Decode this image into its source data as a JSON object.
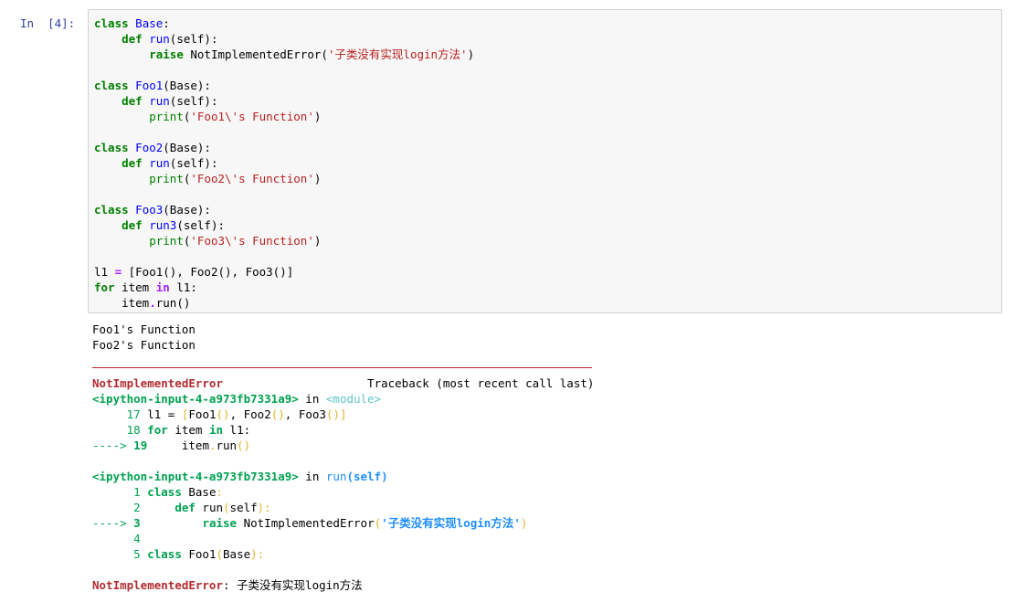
{
  "cell": {
    "prompt": "In  [4]:",
    "code": [
      "class Base:",
      "    def run(self):",
      "        raise NotImplementedError('子类没有实现login方法')",
      "",
      "class Foo1(Base):",
      "    def run(self):",
      "        print('Foo1\\'s Function')",
      "",
      "class Foo2(Base):",
      "    def run(self):",
      "        print('Foo2\\'s Function')",
      "",
      "class Foo3(Base):",
      "    def run3(self):",
      "        print('Foo3\\'s Function')",
      "",
      "l1 = [Foo1(), Foo2(), Foo3()]",
      "for item in l1:",
      "    item.run()"
    ]
  },
  "output": {
    "stdout": [
      "Foo1's Function",
      "Foo2's Function"
    ],
    "traceback": {
      "error_name": "NotImplementedError",
      "header_right": "Traceback (most recent call last)",
      "frame1": {
        "location": "<ipython-input-4-a973fb7331a9>",
        "in_text": " in ",
        "scope": "<module>",
        "lines": [
          {
            "no": "17",
            "text": "l1 = [Foo1(), Foo2(), Foo3()]",
            "current": false
          },
          {
            "no": "18",
            "text": "for item in l1:",
            "current": false
          },
          {
            "no": "19",
            "text": "    item.run()",
            "current": true
          }
        ]
      },
      "frame2": {
        "location": "<ipython-input-4-a973fb7331a9>",
        "in_text": " in ",
        "scope": "run(self)",
        "lines": [
          {
            "no": "1",
            "text": "class Base:",
            "current": false
          },
          {
            "no": "2",
            "text": "    def run(self):",
            "current": false
          },
          {
            "no": "3",
            "text": "        raise NotImplementedError('子类没有实现login方法')",
            "current": true
          },
          {
            "no": "4",
            "text": "",
            "current": false
          },
          {
            "no": "5",
            "text": "class Foo1(Base):",
            "current": false
          }
        ]
      },
      "arrow": "---->",
      "final_error_name": "NotImplementedError",
      "final_message": ": 子类没有实现login方法"
    }
  },
  "colors": {
    "prompt": "#303f9f",
    "cell_bg": "#f7f7f7",
    "cell_border": "#cfcfcf",
    "error_red": "#b22b31",
    "tb_green": "#00a250",
    "tb_blue": "#208ffb"
  }
}
